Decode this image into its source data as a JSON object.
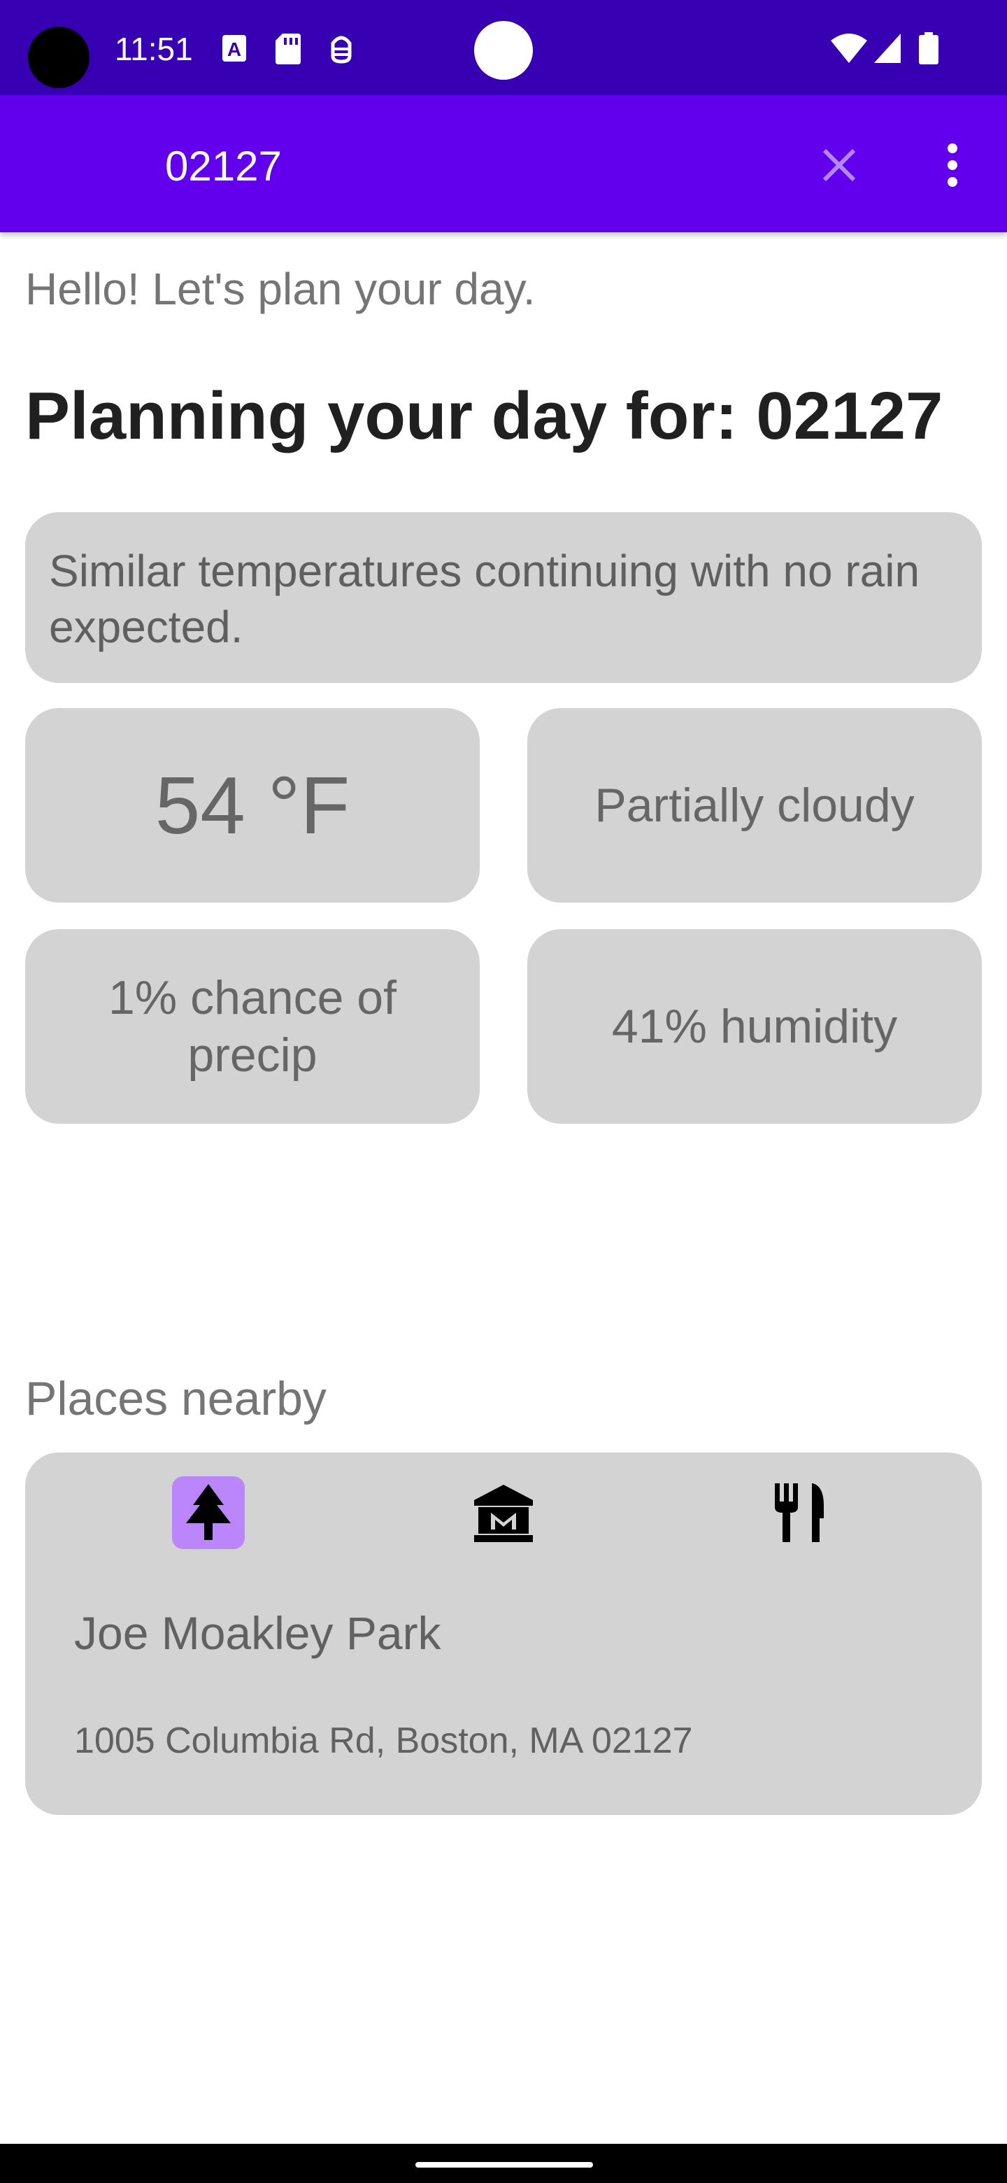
{
  "status_bar": {
    "time": "11:51",
    "icons": [
      "text-a-icon",
      "sd-card-icon",
      "android-debug-icon",
      "wifi-icon",
      "cellular-signal-icon",
      "battery-icon"
    ]
  },
  "app_bar": {
    "search_value": "02127",
    "clear_icon": "close-icon",
    "menu_icon": "more-vert-icon"
  },
  "main": {
    "greeting": "Hello! Let's plan your day.",
    "heading": "Planning your day for: 02127",
    "summary": "Similar temperatures continuing with no rain expected.",
    "tiles": {
      "temperature": "54 °F",
      "condition": "Partially cloudy",
      "precip": "1% chance of precip",
      "humidity": "41% humidity"
    }
  },
  "places": {
    "label": "Places nearby",
    "categories": [
      {
        "icon": "park-tree-icon",
        "selected": true
      },
      {
        "icon": "museum-icon",
        "selected": false
      },
      {
        "icon": "restaurant-icon",
        "selected": false
      }
    ],
    "selected_place": {
      "name": "Joe Moakley Park",
      "address": "1005 Columbia Rd, Boston, MA 02127"
    }
  },
  "colors": {
    "status_bar": "#3700b3",
    "app_bar": "#6200ee",
    "card": "#d3d3d3",
    "selected_category": "#bb86fc"
  }
}
